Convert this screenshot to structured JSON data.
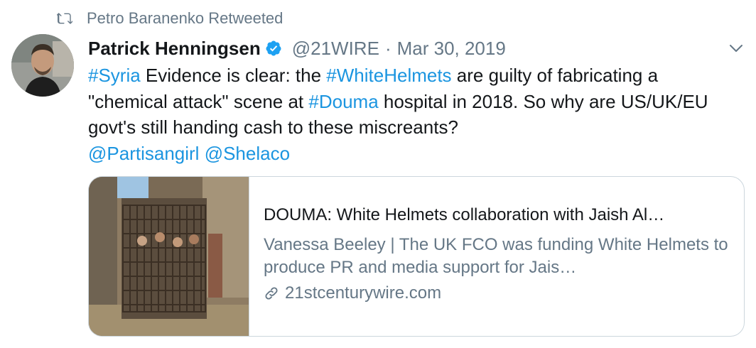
{
  "retweet": {
    "icon": "retweet-icon",
    "label": "Petro Baranenko Retweeted"
  },
  "author": {
    "avatar_icon": "user-avatar",
    "name": "Patrick Henningsen",
    "verified_icon": "verified-badge-icon",
    "handle": "@21WIRE",
    "separator": "·",
    "date": "Mar 30, 2019"
  },
  "menu": {
    "icon": "chevron-down-icon"
  },
  "text": {
    "hashtag_syria": "#Syria",
    "part1": " Evidence is clear: the ",
    "hashtag_whitehelmets": "#WhiteHelmets",
    "part2": " are guilty of fabricating a \"chemical attack\" scene at ",
    "hashtag_douma": "#Douma",
    "part3": " hospital in 2018. So why are US/UK/EU govt's still handing cash to these miscreants?",
    "mention1": "@Partisangirl",
    "space": " ",
    "mention2": "@Shelaco"
  },
  "card": {
    "image_alt": "Caged people on a war-damaged street",
    "title": "DOUMA: White Helmets collaboration with Jaish Al…",
    "description": "Vanessa Beeley | The UK FCO was funding White Helmets to produce PR and media support for Jais…",
    "link_icon": "link-icon",
    "domain": "21stcenturywire.com"
  },
  "colors": {
    "link": "#1b95e0",
    "secondary": "#657786",
    "border": "#ccd6dd",
    "verified": "#1da1f2"
  }
}
